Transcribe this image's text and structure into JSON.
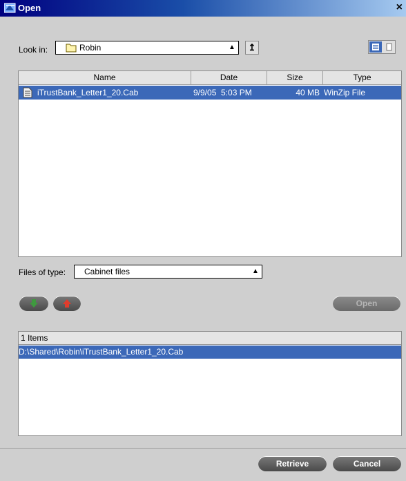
{
  "window": {
    "title": "Open",
    "close_glyph": "×"
  },
  "look_in": {
    "label": "Look in:",
    "value": "Robin",
    "up_icon": "up-folder-icon"
  },
  "file_list": {
    "columns": [
      "Name",
      "Date",
      "Size",
      "Type"
    ],
    "rows": [
      {
        "name": "iTrustBank_Letter1_20.Cab",
        "date": "9/9/05  5:03 PM",
        "size": "40 MB",
        "type": "WinZip File"
      }
    ]
  },
  "files_of_type": {
    "label": "Files of type:",
    "value": "Cabinet files"
  },
  "buttons": {
    "open": "Open",
    "retrieve": "Retrieve",
    "cancel": "Cancel"
  },
  "items": {
    "header": "1 Items",
    "entries": [
      "D:\\Shared\\Robin\\iTrustBank_Letter1_20.Cab"
    ]
  },
  "colors": {
    "selection": "#3b68b8",
    "title_start": "#000080",
    "title_end": "#a6caf0",
    "add_arrow": "#3f9a3f",
    "remove_arrow": "#e03c2c"
  }
}
